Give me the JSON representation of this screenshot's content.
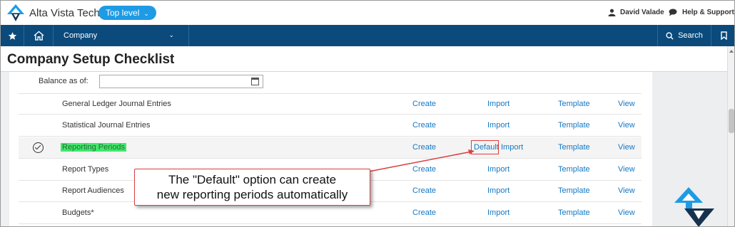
{
  "header": {
    "app_title": "Alta Vista Tech",
    "entity_selector": "Top level",
    "user_name": "David Valade",
    "help_label": "Help & Support"
  },
  "nav": {
    "company_label": "Company",
    "search_label": "Search"
  },
  "page": {
    "title": "Company Setup Checklist",
    "balance_label": "Balance as of:",
    "balance_value": ""
  },
  "rows": [
    {
      "name": "General Ledger Journal Entries",
      "create": "Create",
      "import": "Import",
      "template": "Template",
      "view": "View"
    },
    {
      "name": "Statistical Journal Entries",
      "create": "Create",
      "import": "Import",
      "template": "Template",
      "view": "View"
    },
    {
      "name": "Reporting Periods",
      "create": "Create",
      "default": "Default",
      "import": "Import",
      "template": "Template",
      "view": "View",
      "completed": true
    },
    {
      "name": "Report Types",
      "create": "Create",
      "import": "Import",
      "template": "Template",
      "view": "View"
    },
    {
      "name": "Report Audiences",
      "create": "Create",
      "import": "Import",
      "template": "Template",
      "view": "View"
    },
    {
      "name": "Budgets*",
      "create": "Create",
      "import": "Import",
      "template": "Template",
      "view": "View"
    }
  ],
  "callout": {
    "line1": "The \"Default\" option can create",
    "line2": "new reporting periods automatically"
  },
  "colors": {
    "nav_bg": "#0b4a7b",
    "accent": "#1e9be4",
    "link": "#1478c4",
    "highlight": "#40e86b",
    "callout_border": "#d94040"
  }
}
